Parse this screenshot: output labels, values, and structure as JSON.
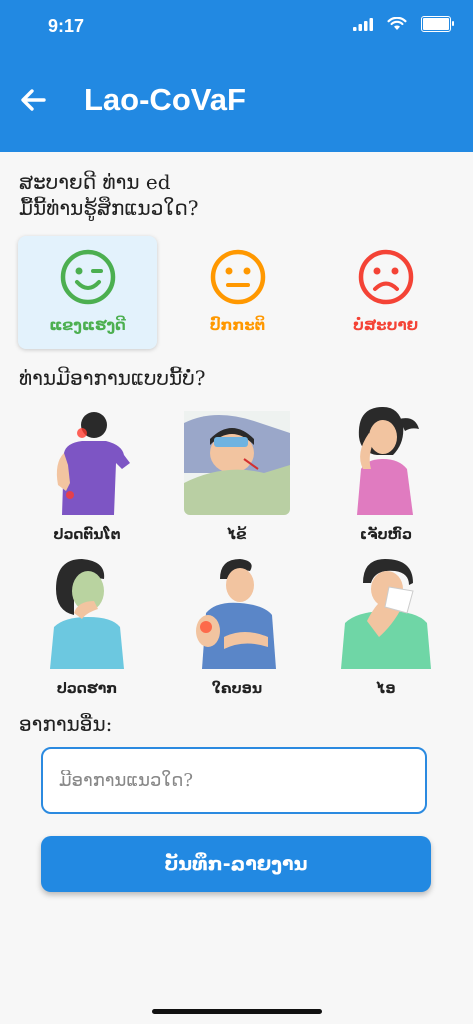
{
  "status_bar": {
    "time": "9:17"
  },
  "header": {
    "title": "Lao-CoVaF"
  },
  "greeting": {
    "line1": "ສະບາຍດີ ທ່ານ ed",
    "line2": "ມື້ນີ້ທ່ານຮູ້ສຶກແນວໃດ?"
  },
  "moods": [
    {
      "label": "ແຂງແຮງດີ",
      "color": "#4caf50",
      "selected": true
    },
    {
      "label": "ປົກກະຕິ",
      "color": "#ff9800",
      "selected": false
    },
    {
      "label": "ບໍ່ສະບາຍ",
      "color": "#f44336",
      "selected": false
    }
  ],
  "symptoms_prompt": "ທ່ານມີອາການແບບນີ້ບໍ່?",
  "symptoms": [
    {
      "label": "ປວດຕົນໂຕ"
    },
    {
      "label": "ໄຂ້"
    },
    {
      "label": "ເຈັບຫົວ"
    },
    {
      "label": "ປວດຮາກ"
    },
    {
      "label": "ໃຄບອນ"
    },
    {
      "label": "ໄອ"
    }
  ],
  "other_symptoms": {
    "label": "ອາການອື່ນ:",
    "placeholder": "ມີອາການແນວໃດ?"
  },
  "submit_label": "ບັນທຶກ-ລາຍງານ"
}
